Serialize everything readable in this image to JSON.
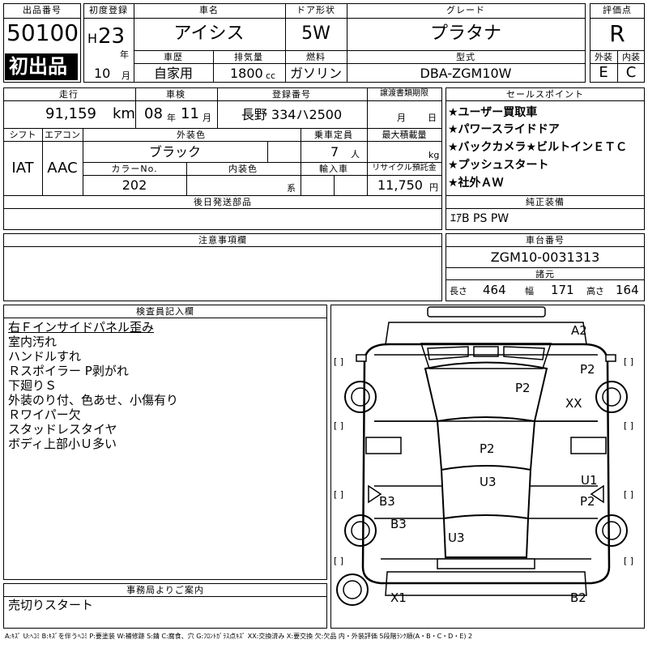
{
  "header": {
    "lot_no_label": "出品番号",
    "lot_no": "50100",
    "first_listing": "初出品",
    "first_reg_label": "初度登録",
    "era": "H",
    "year": "23",
    "year_unit": "年",
    "month": "10",
    "month_unit": "月",
    "car_name_label": "車名",
    "car_name": "アイシス",
    "door_label": "ドア形状",
    "door": "5W",
    "grade_label": "グレード",
    "grade": "プラタナ",
    "score_label": "評価点",
    "score": "R",
    "history_label": "車歴",
    "history": "自家用",
    "displacement_label": "排気量",
    "displacement": "1800",
    "displacement_unit": "cc",
    "fuel_label": "燃料",
    "fuel": "ガソリン",
    "model_label": "型式",
    "model": "DBA-ZGM10W",
    "exterior_label": "外装",
    "exterior": "E",
    "interior_label": "内装",
    "interior": "C"
  },
  "row2": {
    "mileage_label": "走行",
    "mileage": "91,159",
    "mileage_unit": "km",
    "inspection_label": "車検",
    "insp_year": "08",
    "insp_year_unit": "年",
    "insp_month": "11",
    "insp_month_unit": "月",
    "plate_label": "登録番号",
    "plate": "長野 334ハ2500",
    "transfer_label": "譲渡書類期限",
    "transfer_month": "月",
    "transfer_day": "日",
    "shift_label": "シフト",
    "shift": "IAT",
    "ac_label": "エアコン",
    "ac": "AAC",
    "color_label": "外装色",
    "color": "ブラック",
    "capacity_label": "乗車定員",
    "capacity": "7",
    "capacity_unit": "人",
    "load_label": "最大積載量",
    "load_unit": "kg",
    "color_no_label": "カラーNo.",
    "color_no": "202",
    "interior_color_label": "内装色",
    "interior_color_unit": "系",
    "import_label": "輸入車",
    "recycle_label": "リサイクル預託金",
    "recycle": "11,750",
    "recycle_unit": "円",
    "later_parts_label": "後日発送部品"
  },
  "sales": {
    "label": "セールスポイント",
    "points": [
      "★ユーザー買取車",
      "★パワースライドドア",
      "★バックカメラ★ビルトインＥＴＣ",
      "★プッシュスタート",
      "★社外ＡＷ"
    ],
    "equipment_label": "純正装備",
    "equipment": "ｴｱB PS PW"
  },
  "notes": {
    "label": "注意事項欄"
  },
  "chassis": {
    "label": "車台番号",
    "number": "ZGM10-0031313",
    "dims_label": "諸元",
    "length_label": "長さ",
    "length": "464",
    "width_label": "幅",
    "width": "171",
    "height_label": "高さ",
    "height": "164"
  },
  "inspector": {
    "label": "検査員記入欄",
    "lines": [
      "右Ｆインサイドパネル歪み",
      "室内汚れ",
      "ハンドルすれ",
      "Ｒスポイラー P剥がれ",
      "下廻りＳ",
      "外装のり付、色あせ、小傷有り",
      "Ｒワイパー欠",
      "スタッドレスタイヤ",
      "ボディ上部小Ｕ多い"
    ]
  },
  "office": {
    "label": "事務局よりご案内",
    "text": "売切りスタート"
  },
  "diagram": {
    "marks": [
      "A2",
      "P2",
      "P2",
      "XX",
      "P2",
      "U3",
      "U1",
      "B3",
      "P2",
      "B3",
      "U3",
      "X1",
      "B2"
    ],
    "brackets": "[ ]"
  },
  "legend": "A:ｷｽﾞ U:ﾍｺﾐ B:ｷｽﾞを伴うﾍｺﾐ P:要塗装 W:補修跡 S:錆 C:腐食、穴 G:ﾌﾛﾝﾄｶﾞﾗｽ点ｷｽﾞ XX:交換済み X:要交換 欠:欠品 内・外装評価 5段階ﾗﾝｸ順(A・B・C・D・E) 2"
}
